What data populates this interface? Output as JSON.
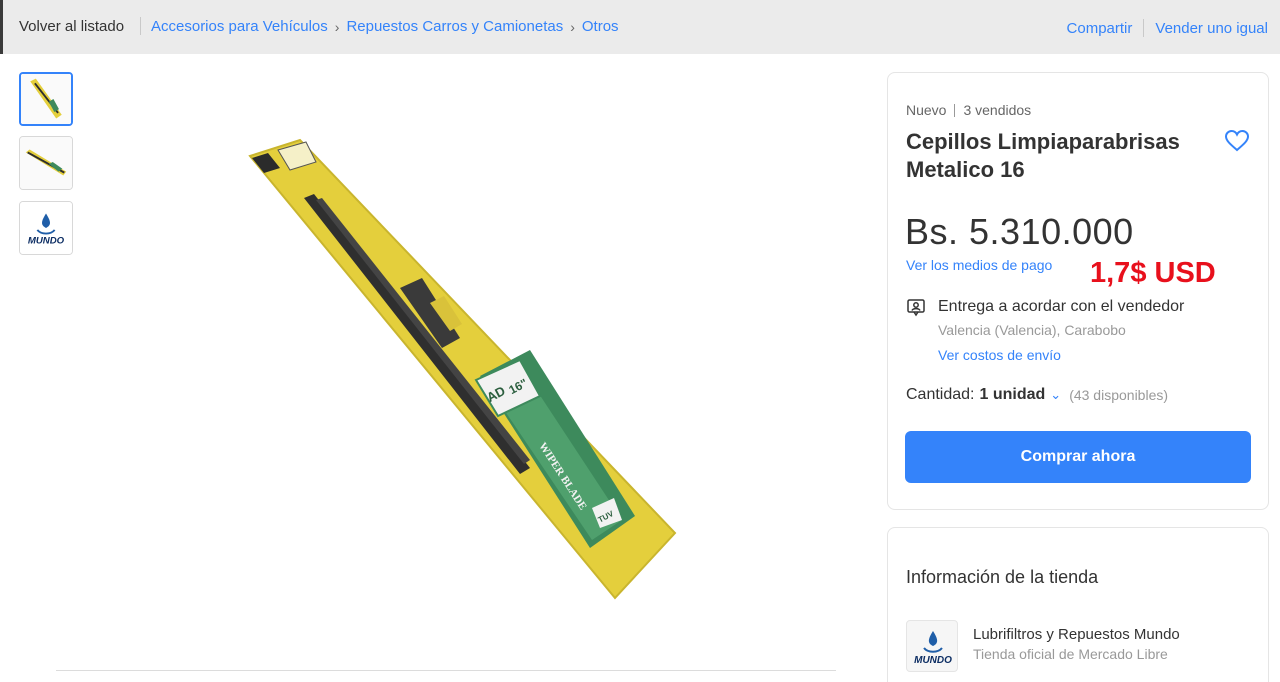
{
  "header": {
    "back_label": "Volver al listado",
    "breadcrumb": [
      "Accesorios para Vehículos",
      "Repuestos Carros y Camionetas",
      "Otros"
    ],
    "share_label": "Compartir",
    "sell_label": "Vender uno igual"
  },
  "thumbnails": [
    {
      "icon": "wiper-package-thumb",
      "active": true
    },
    {
      "icon": "wiper-blade-thumb",
      "active": false
    },
    {
      "icon": "mundo-logo-thumb",
      "active": false
    }
  ],
  "product": {
    "condition": "Nuevo",
    "sold": "3 vendidos",
    "title": "Cepillos Limpiaparabrisas Metalico 16",
    "price": "Bs. 5.310.000",
    "payment_link": "Ver los medios de pago",
    "usd_note": "1,7$ USD",
    "delivery": "Entrega a acordar con el vendedor",
    "location": "Valencia (Valencia), Carabobo",
    "shipping_link": "Ver costos de envío",
    "quantity_label": "Cantidad:",
    "quantity_value": "1 unidad",
    "available": "(43 disponibles)",
    "buy_label": "Comprar ahora"
  },
  "store": {
    "heading": "Información de la tienda",
    "name": "Lubrifiltros y Repuestos Mundo",
    "subtitle": "Tienda oficial de Mercado Libre",
    "logo_text": "MUNDO"
  },
  "image_labels": {
    "brand": "AD",
    "size": "16\"",
    "product_text": "WIPER BLADE",
    "badge": "TUV"
  },
  "colors": {
    "accent": "#3483fa",
    "usd_note": "#e8101c",
    "package_yellow": "#e4cf3c",
    "package_green": "#3d8a5c"
  }
}
